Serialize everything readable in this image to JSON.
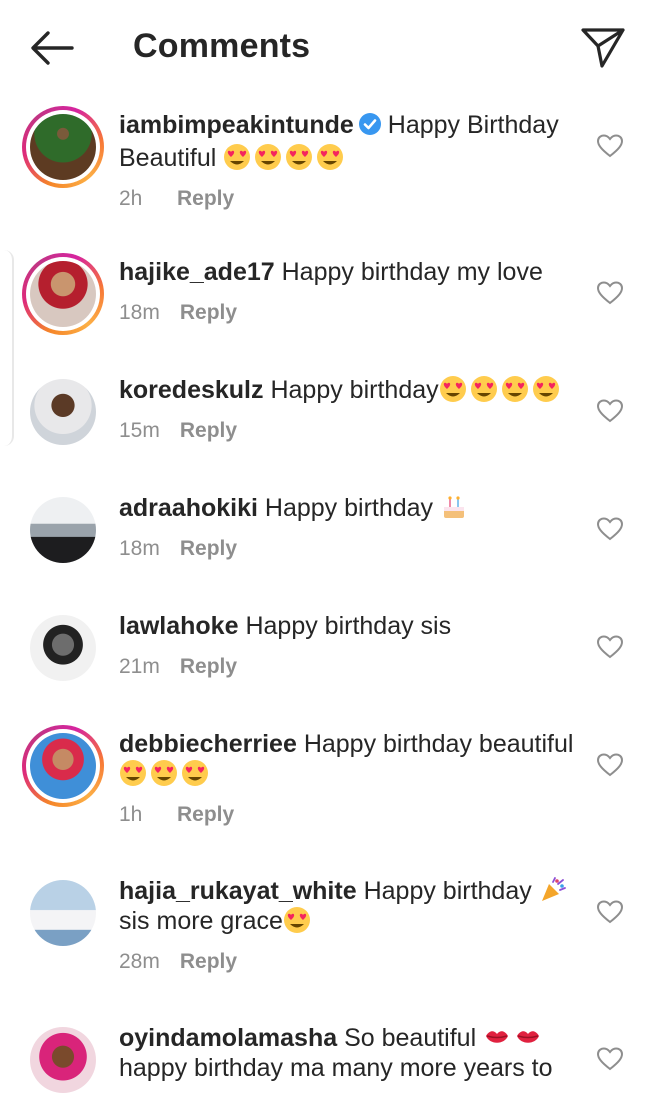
{
  "header": {
    "title": "Comments",
    "back_icon": "arrow-left-icon",
    "send_icon": "paper-plane-icon"
  },
  "comments": [
    {
      "username": "iambimpeakintunde",
      "verified": true,
      "text": "Happy Birthday Beautiful",
      "emojis": [
        "heart-eyes",
        "heart-eyes",
        "heart-eyes",
        "heart-eyes"
      ],
      "time": "2h",
      "reply": "Reply",
      "story_ring": true
    },
    {
      "username": "hajike_ade17",
      "verified": false,
      "text": "Happy birthday my love",
      "emojis": [],
      "time": "18m",
      "reply": "Reply",
      "story_ring": true
    },
    {
      "username": "koredeskulz",
      "verified": false,
      "text": "Happy birthday",
      "emojis": [
        "heart-eyes",
        "heart-eyes",
        "heart-eyes",
        "heart-eyes"
      ],
      "time": "15m",
      "reply": "Reply",
      "story_ring": false
    },
    {
      "username": "adraahokiki",
      "verified": false,
      "text": "Happy birthday",
      "emojis": [
        "birthday-cake"
      ],
      "time": "18m",
      "reply": "Reply",
      "story_ring": false
    },
    {
      "username": "lawlahoke",
      "verified": false,
      "text": "Happy birthday sis",
      "emojis": [],
      "time": "21m",
      "reply": "Reply",
      "story_ring": false
    },
    {
      "username": "debbiecherriee",
      "verified": false,
      "text": "Happy birthday beautiful",
      "emojis": [
        "heart-eyes",
        "heart-eyes",
        "heart-eyes"
      ],
      "time": "1h",
      "reply": "Reply",
      "story_ring": true
    },
    {
      "username": "hajia_rukayat_white",
      "verified": false,
      "text": "Happy birthday",
      "emojis_mid": [
        "party-popper"
      ],
      "text2": "sis more grace",
      "emojis": [
        "heart-eyes"
      ],
      "time": "28m",
      "reply": "Reply",
      "story_ring": false
    },
    {
      "username": "oyindamolamasha",
      "verified": false,
      "text": "So beautiful",
      "emojis_mid": [
        "kiss-mark",
        "kiss-mark"
      ],
      "text2": "happy birthday ma many more years to",
      "emojis": [],
      "time": "",
      "reply": "",
      "story_ring": false
    }
  ],
  "colors": {
    "text": "#262626",
    "meta": "#8e8e8e",
    "verified": "#3897f0",
    "emoji": "#ffcc4d",
    "heart_emoji": "#f4245e"
  }
}
